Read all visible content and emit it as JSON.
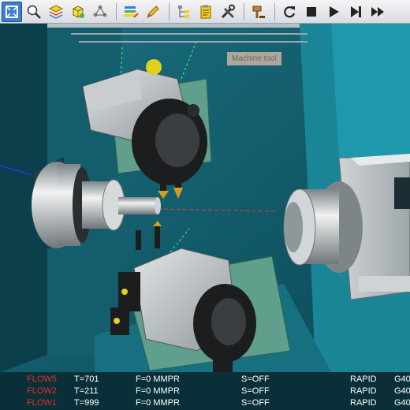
{
  "toolbar": {
    "buttons": [
      {
        "icon": "fit-view-icon",
        "active": true
      },
      {
        "icon": "zoom-icon"
      },
      {
        "icon": "layers-icon"
      },
      {
        "icon": "cube-view-icon"
      },
      {
        "icon": "network-icon"
      },
      {
        "icon": "stack-edit-icon"
      },
      {
        "icon": "pencil-icon"
      },
      {
        "icon": "tree-icon"
      },
      {
        "icon": "clipboard-icon"
      },
      {
        "icon": "tools-icon"
      },
      {
        "icon": "hammer-icon"
      },
      {
        "icon": "reset-icon"
      },
      {
        "icon": "stop-icon"
      },
      {
        "icon": "play-icon"
      },
      {
        "icon": "step-icon"
      },
      {
        "icon": "fast-forward-icon"
      }
    ],
    "tooltip": "Machine tool"
  },
  "status": {
    "rows": [
      {
        "flow": "FLOW5",
        "tool": "T=701",
        "feed": "F=0 MMPR",
        "spindle": "S=OFF",
        "mode": "RAPID",
        "gcode": "G40"
      },
      {
        "flow": "FLOW2",
        "tool": "T=211",
        "feed": "F=0 MMPR",
        "spindle": "S=OFF",
        "mode": "RAPID",
        "gcode": "G40"
      },
      {
        "flow": "FLOW1",
        "tool": "T=999",
        "feed": "F=0 MMPR",
        "spindle": "S=OFF",
        "mode": "RAPID",
        "gcode": "G40"
      }
    ]
  },
  "colors": {
    "background": "#0f5666",
    "flow_label": "#e0302a",
    "status_bg": "#0a2f38",
    "active_button": "#3a7fd0"
  }
}
